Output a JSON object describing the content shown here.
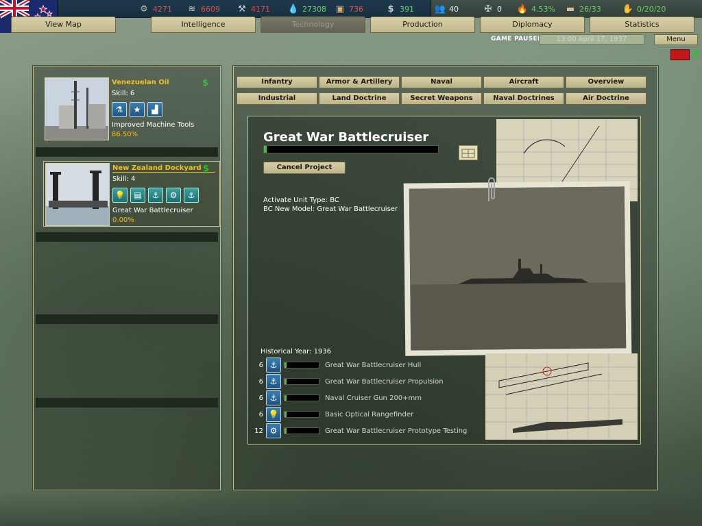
{
  "resources": [
    {
      "icon": "energy-icon",
      "value": "4271",
      "tone": "bad"
    },
    {
      "icon": "metal-icon",
      "value": "6609",
      "tone": "bad"
    },
    {
      "icon": "rare-materials-icon",
      "value": "4171",
      "tone": "bad"
    },
    {
      "icon": "oil-icon",
      "value": "27308",
      "tone": "ok"
    },
    {
      "icon": "supplies-icon",
      "value": "736",
      "tone": "bad"
    },
    {
      "icon": "money-icon",
      "value": "391",
      "tone": "ok"
    }
  ],
  "stats": [
    {
      "icon": "manpower-icon",
      "value": "40"
    },
    {
      "icon": "transport-icon",
      "value": "0"
    },
    {
      "icon": "dissent-icon",
      "value": "4.53%"
    },
    {
      "icon": "convoy-icon",
      "value": "26/33"
    },
    {
      "icon": "diplomats-icon",
      "value": "0/20/20"
    }
  ],
  "tabs": [
    "View Map",
    "Intelligence",
    "Technology",
    "Production",
    "Diplomacy",
    "Statistics"
  ],
  "status": {
    "paused": "GAME PAUSED",
    "date": "13:00 April 17, 1937",
    "menu": "Menu"
  },
  "projects": [
    {
      "name": "Venezuelan Oil",
      "skill": "Skill: 6",
      "icons": [
        "science-icon",
        "star-icon",
        "factory-icon"
      ],
      "task": "Improved Machine Tools",
      "progress": "86.50%",
      "money": "$"
    },
    {
      "name": "New Zealand Dockyard",
      "skill": "Skill: 4",
      "icons": [
        "lightbulb-icon",
        "blueprint-icon",
        "anchor-icon",
        "gears-icon",
        "anchor-gun-icon"
      ],
      "task": "Great War Battlecruiser",
      "progress": "0.00%",
      "money": "$"
    }
  ],
  "categories_row1": [
    "Infantry",
    "Armor & Artillery",
    "Naval",
    "Aircraft",
    "Overview"
  ],
  "categories_row2": [
    "Industrial",
    "Land Doctrine",
    "Secret Weapons",
    "Naval Doctrines",
    "Air Doctrine"
  ],
  "detail": {
    "title": "Great War Battlecruiser",
    "progress_fraction": 0.01,
    "cancel": "Cancel Project",
    "effects": [
      "Activate Unit Type: BC",
      "BC New Model: Great War Battlecruiser"
    ],
    "historical_year": "Historical Year: 1936",
    "components": [
      {
        "difficulty": "6",
        "icon": "anchor-icon",
        "name": "Great War Battlecruiser Hull"
      },
      {
        "difficulty": "6",
        "icon": "anchor-icon",
        "name": "Great War Battlecruiser Propulsion"
      },
      {
        "difficulty": "6",
        "icon": "anchor-gun-icon",
        "name": "Naval Cruiser Gun 200+mm"
      },
      {
        "difficulty": "6",
        "icon": "lightbulb-icon",
        "name": "Basic Optical Rangefinder"
      },
      {
        "difficulty": "12",
        "icon": "gears-icon",
        "name": "Great War Battlecruiser Prototype Testing"
      }
    ]
  },
  "colors": {
    "accent_gold": "#f0c020",
    "money_green": "#2ec02e",
    "bad_red": "#e05050",
    "good_green": "#68d066"
  }
}
